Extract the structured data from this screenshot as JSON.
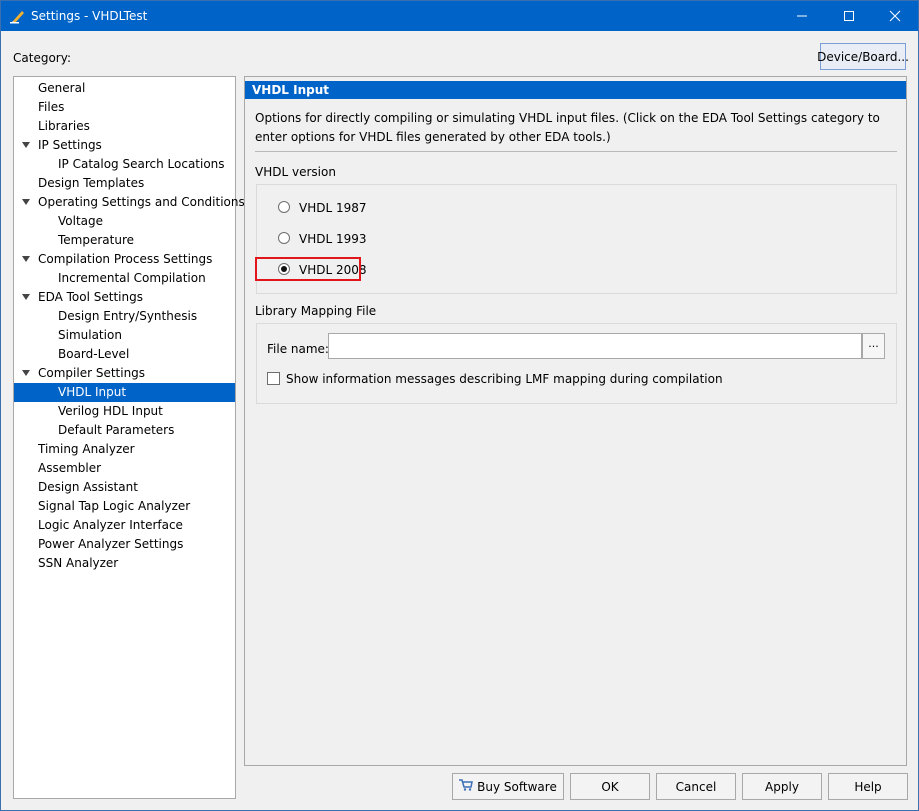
{
  "window": {
    "title": "Settings - VHDLTest"
  },
  "category_label": "Category:",
  "device_board_label": "Device/Board...",
  "tree": [
    {
      "label": "General",
      "level": 0
    },
    {
      "label": "Files",
      "level": 0
    },
    {
      "label": "Libraries",
      "level": 0
    },
    {
      "label": "IP Settings",
      "level": 0,
      "expanded": true
    },
    {
      "label": "IP Catalog Search Locations",
      "level": 1
    },
    {
      "label": "Design Templates",
      "level": 0
    },
    {
      "label": "Operating Settings and Conditions",
      "level": 0,
      "expanded": true
    },
    {
      "label": "Voltage",
      "level": 1
    },
    {
      "label": "Temperature",
      "level": 1
    },
    {
      "label": "Compilation Process Settings",
      "level": 0,
      "expanded": true
    },
    {
      "label": "Incremental Compilation",
      "level": 1
    },
    {
      "label": "EDA Tool Settings",
      "level": 0,
      "expanded": true
    },
    {
      "label": "Design Entry/Synthesis",
      "level": 1
    },
    {
      "label": "Simulation",
      "level": 1
    },
    {
      "label": "Board-Level",
      "level": 1
    },
    {
      "label": "Compiler Settings",
      "level": 0,
      "expanded": true
    },
    {
      "label": "VHDL Input",
      "level": 1,
      "selected": true
    },
    {
      "label": "Verilog HDL Input",
      "level": 1
    },
    {
      "label": "Default Parameters",
      "level": 1
    },
    {
      "label": "Timing Analyzer",
      "level": 0
    },
    {
      "label": "Assembler",
      "level": 0
    },
    {
      "label": "Design Assistant",
      "level": 0
    },
    {
      "label": "Signal Tap Logic Analyzer",
      "level": 0
    },
    {
      "label": "Logic Analyzer Interface",
      "level": 0
    },
    {
      "label": "Power Analyzer Settings",
      "level": 0
    },
    {
      "label": "SSN Analyzer",
      "level": 0
    }
  ],
  "panel": {
    "header": "VHDL Input",
    "description": "Options for directly compiling or simulating VHDL input files.  (Click on the EDA Tool Settings category to enter options for VHDL files generated by other EDA tools.)",
    "vhdl_version_label": "VHDL version",
    "vhdl_options": [
      {
        "label": "VHDL 1987",
        "checked": false
      },
      {
        "label": "VHDL 1993",
        "checked": false
      },
      {
        "label": "VHDL 2008",
        "checked": true
      }
    ],
    "library_mapping_label": "Library Mapping File",
    "file_name_label": "File name:",
    "file_name_value": "",
    "browse_label": "...",
    "show_info_label": "Show information messages describing LMF mapping during compilation",
    "show_info_checked": false
  },
  "buttons": {
    "buy_software": "Buy Software",
    "ok": "OK",
    "cancel": "Cancel",
    "apply": "Apply",
    "help": "Help"
  },
  "colors": {
    "titlebar": "#0063c7",
    "selection": "#0063c7",
    "highlight": "#e0161b"
  }
}
